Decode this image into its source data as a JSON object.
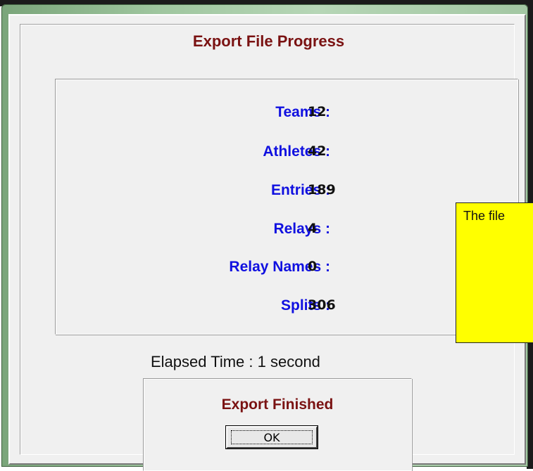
{
  "window": {
    "title": "Export File Progress"
  },
  "counts": [
    {
      "label": "Teams :",
      "value": "12"
    },
    {
      "label": "Athletes :",
      "value": "42"
    },
    {
      "label": "Entries :",
      "value": "189"
    },
    {
      "label": "Relays :",
      "value": "4"
    },
    {
      "label": "Relay Names :",
      "value": "0"
    },
    {
      "label": "Splits :",
      "value": "306"
    }
  ],
  "elapsed": {
    "text": "Elapsed Time : 1 second"
  },
  "finish": {
    "status": "Export Finished",
    "ok_label": "OK"
  },
  "tooltip": {
    "text": "The file"
  },
  "colors": {
    "title": "#7a1212",
    "label": "#1010e0",
    "tooltip_bg": "#ffff00",
    "frame": "#9fc69f"
  }
}
